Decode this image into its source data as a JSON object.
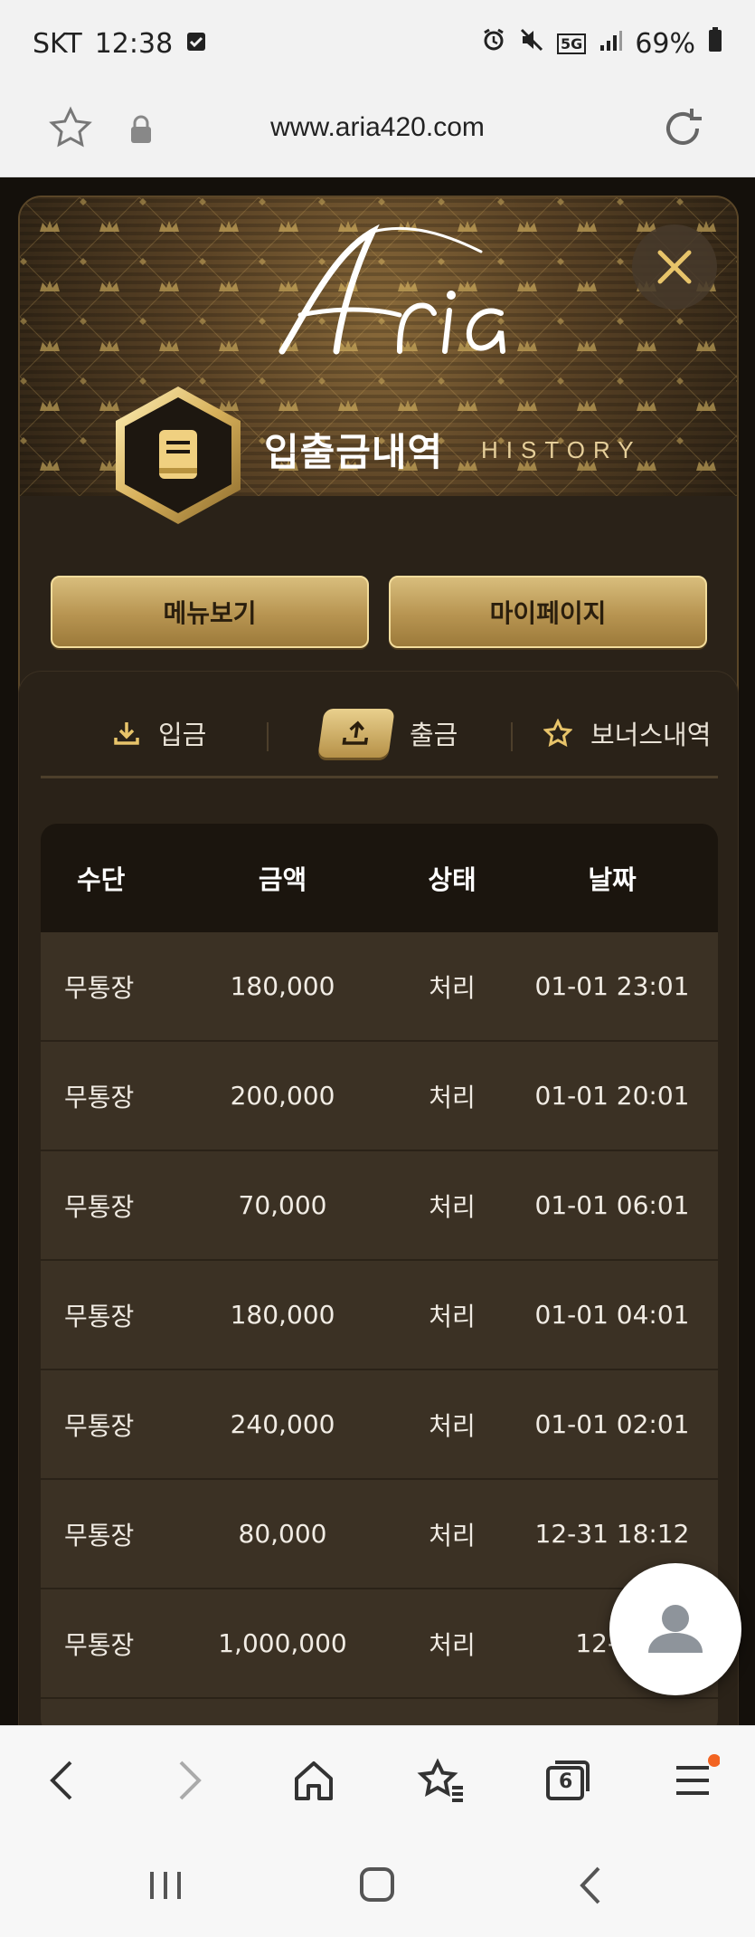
{
  "status_bar": {
    "carrier": "SKT",
    "time": "12:38",
    "network": "5G",
    "battery": "69%"
  },
  "browser": {
    "url": "www.aria420.com",
    "tab_count": "6"
  },
  "header": {
    "title_ko": "입출금내역",
    "title_en": "HISTORY"
  },
  "buttons": {
    "menu": "메뉴보기",
    "mypage": "마이페이지"
  },
  "tabs": [
    {
      "label": "입금",
      "icon": "download-icon"
    },
    {
      "label": "출금",
      "icon": "upload-icon",
      "active": true
    },
    {
      "label": "보너스내역",
      "icon": "star-icon"
    }
  ],
  "table": {
    "headers": [
      "수단",
      "금액",
      "상태",
      "날짜"
    ],
    "rows": [
      {
        "method": "무통장",
        "amount": "180,000",
        "status": "처리",
        "date": "01-01 23:01"
      },
      {
        "method": "무통장",
        "amount": "200,000",
        "status": "처리",
        "date": "01-01 20:01"
      },
      {
        "method": "무통장",
        "amount": "70,000",
        "status": "처리",
        "date": "01-01 06:01"
      },
      {
        "method": "무통장",
        "amount": "180,000",
        "status": "처리",
        "date": "01-01 04:01"
      },
      {
        "method": "무통장",
        "amount": "240,000",
        "status": "처리",
        "date": "01-01 02:01"
      },
      {
        "method": "무통장",
        "amount": "80,000",
        "status": "처리",
        "date": "12-31 18:12"
      },
      {
        "method": "무통장",
        "amount": "1,000,000",
        "status": "처리",
        "date": "12-31"
      }
    ]
  },
  "colors": {
    "gold": "#d8bd7c",
    "panel": "#2a2218",
    "row": "#3b3124",
    "header_row": "#1b150e"
  }
}
